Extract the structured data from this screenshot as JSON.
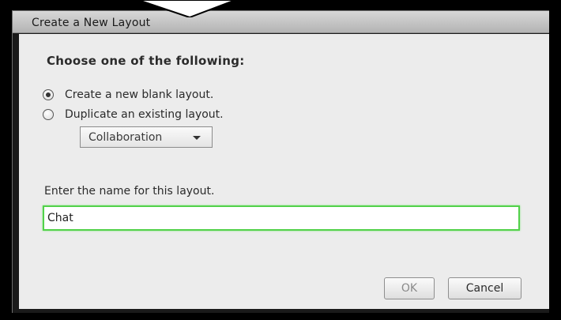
{
  "dialog": {
    "title": "Create a New Layout",
    "heading": "Choose one of the following:",
    "options": [
      {
        "label": "Create a new blank layout.",
        "checked": true
      },
      {
        "label": "Duplicate an existing layout.",
        "checked": false
      }
    ],
    "layout_select": {
      "selected": "Collaboration"
    },
    "name_field": {
      "label": "Enter the name for this layout.",
      "value": "Chat"
    },
    "buttons": {
      "ok": "OK",
      "cancel": "Cancel"
    }
  },
  "colors": {
    "focus_border": "#52d14a",
    "titlebar": "#c4c4c4",
    "background": "#ececec"
  },
  "icons": {
    "dropdown": "chevron-down-icon",
    "callout": "callout-pointer-icon"
  }
}
